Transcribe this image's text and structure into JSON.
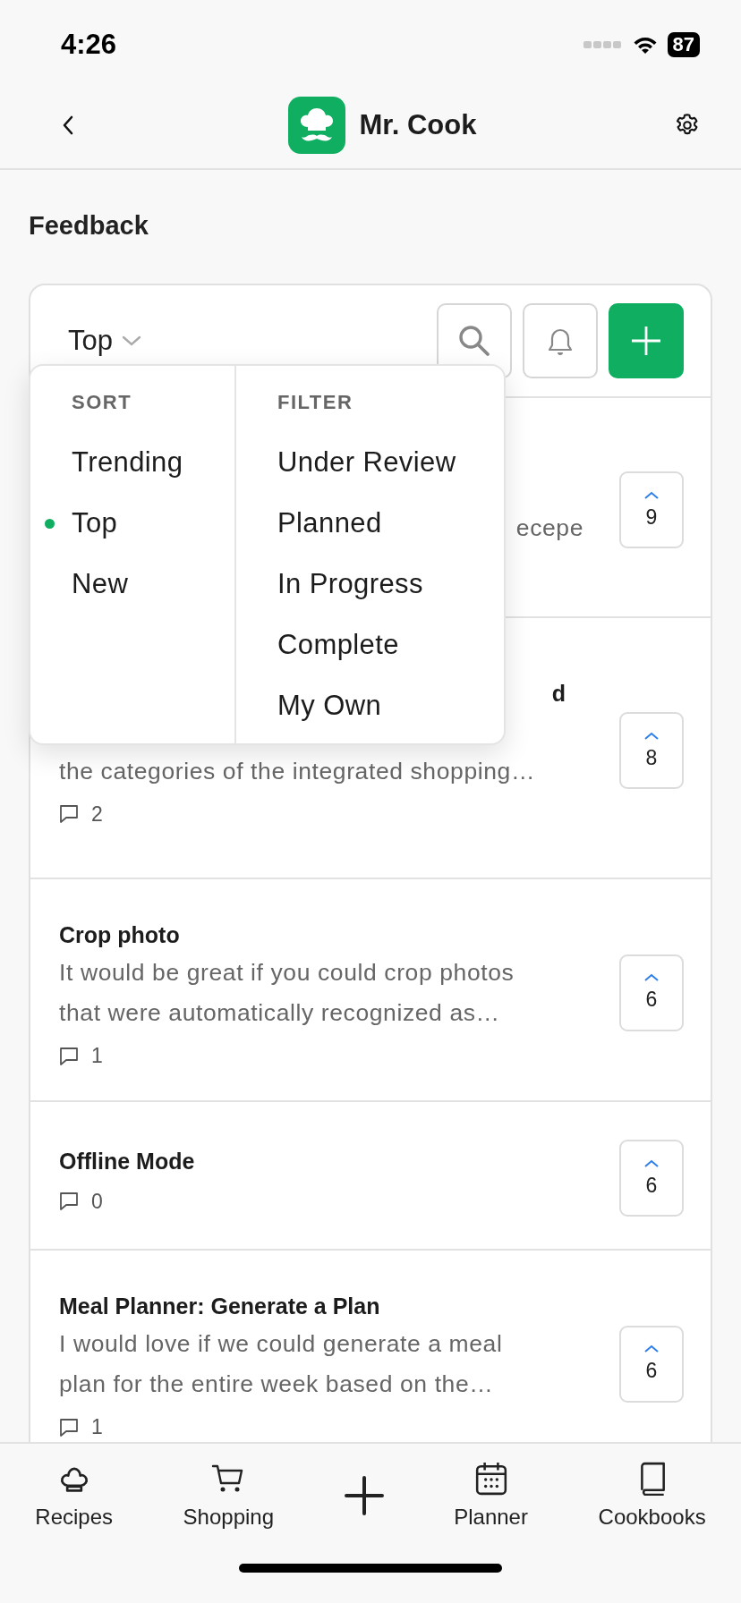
{
  "status_bar": {
    "time": "4:26",
    "battery": "87"
  },
  "header": {
    "title": "Mr. Cook"
  },
  "page_title": "Feedback",
  "sort_button": {
    "label": "Top"
  },
  "menu": {
    "sort_heading": "SORT",
    "filter_heading": "FILTER",
    "sort_options": [
      {
        "label": "Trending",
        "selected": false
      },
      {
        "label": "Top",
        "selected": true
      },
      {
        "label": "New",
        "selected": false
      }
    ],
    "filter_options": [
      {
        "label": "Under Review",
        "selected": false
      },
      {
        "label": "Planned",
        "selected": false
      },
      {
        "label": "In Progress",
        "selected": false
      },
      {
        "label": "Complete",
        "selected": false
      },
      {
        "label": "My Own",
        "selected": false
      }
    ]
  },
  "posts": [
    {
      "description": "ecepe",
      "votes": "9"
    },
    {
      "title": "d",
      "description": "the categories of the integrated shopping…",
      "comments": "2",
      "votes": "8"
    },
    {
      "title": "Crop photo",
      "description": "It would be great if you could crop photos that were automatically recognized as…",
      "comments": "1",
      "votes": "6"
    },
    {
      "title": "Offline Mode",
      "comments": "0",
      "votes": "6"
    },
    {
      "title": "Meal Planner: Generate a Plan",
      "description": "I would love if we could generate a meal plan for the entire week based on the…",
      "comments": "1",
      "votes": "6"
    }
  ],
  "tabs": [
    {
      "label": "Recipes"
    },
    {
      "label": "Shopping"
    },
    {
      "label": "Planner"
    },
    {
      "label": "Cookbooks"
    }
  ]
}
